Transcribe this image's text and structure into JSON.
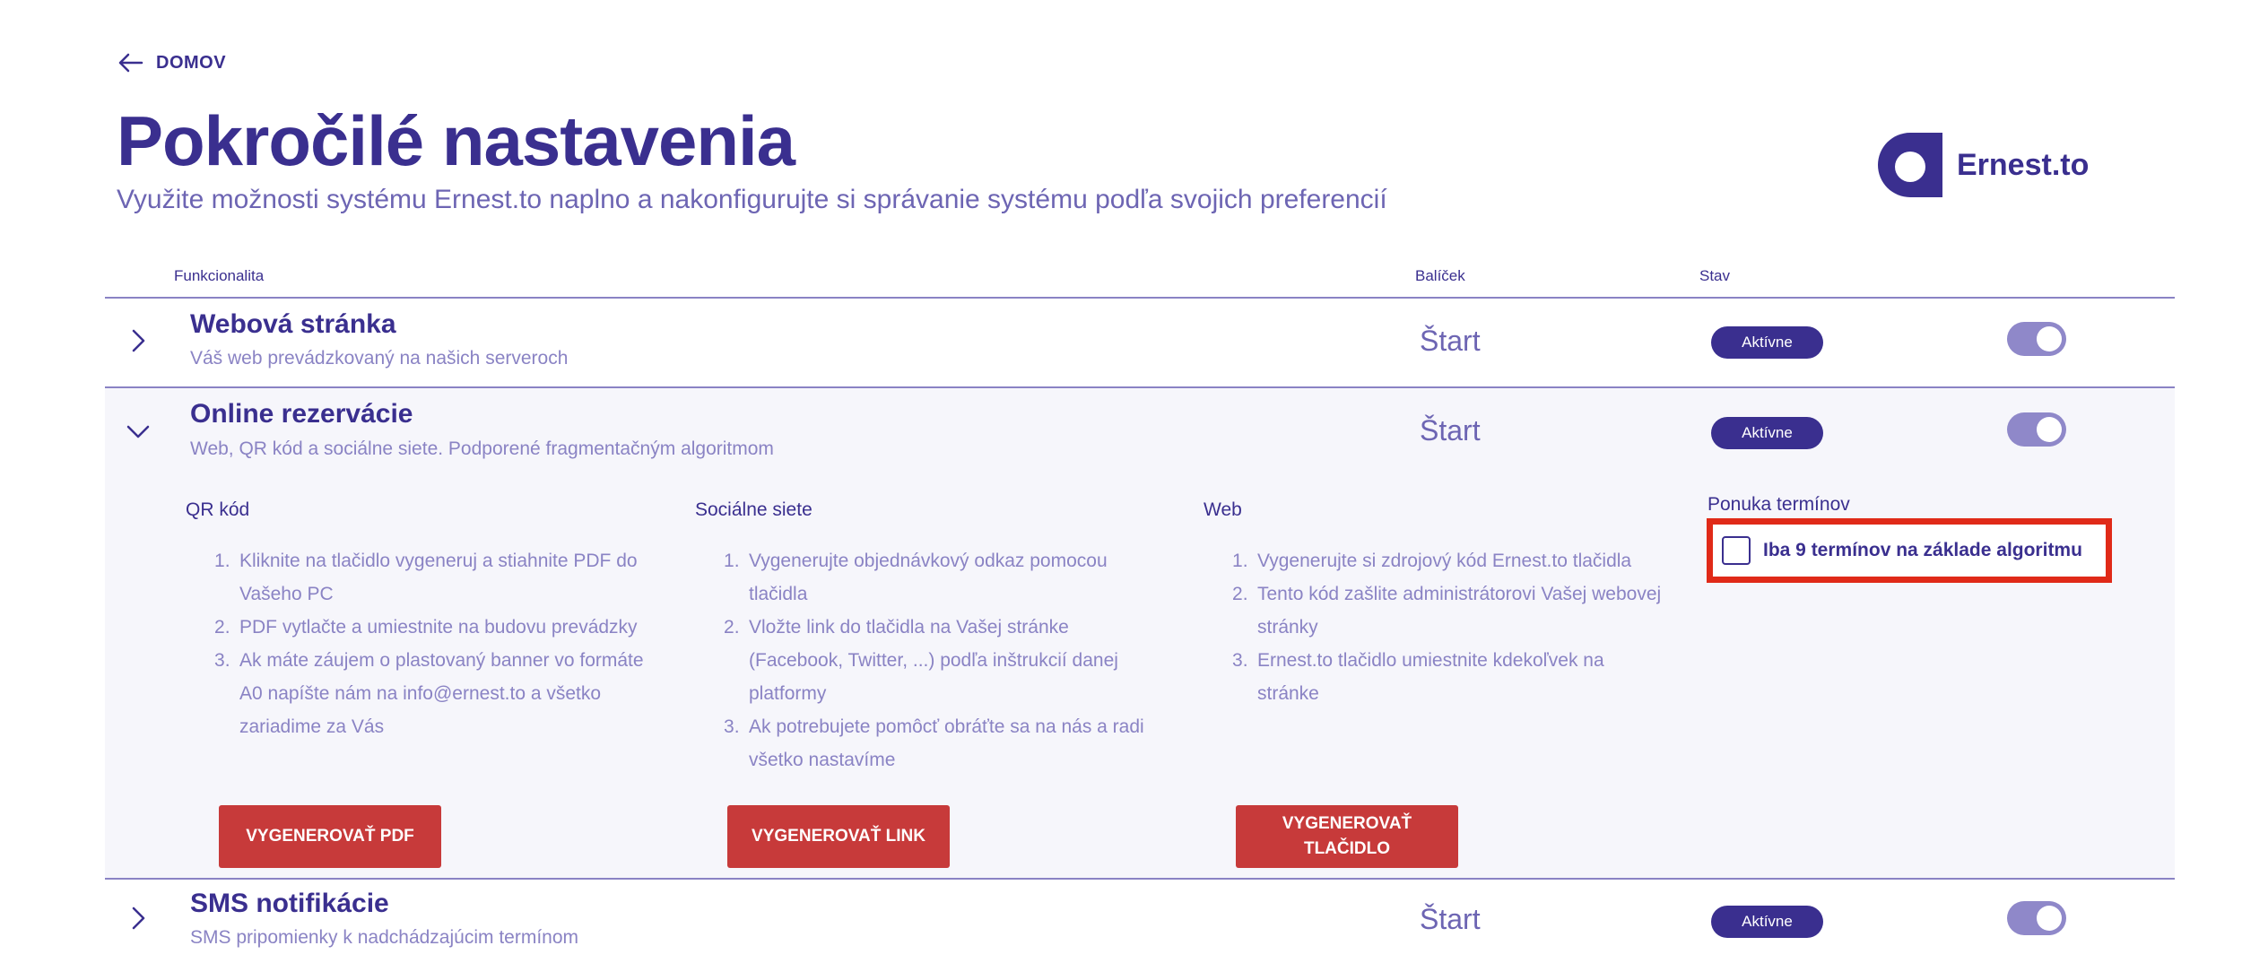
{
  "nav": {
    "back_label": "DOMOV"
  },
  "header": {
    "title": "Pokročilé nastavenia",
    "subtitle": "Využite možnosti systému Ernest.to naplno a nakonfigurujte si správanie systému podľa svojich preferencií"
  },
  "logo": {
    "text": "Ernest.to"
  },
  "table": {
    "columns": {
      "feature": "Funkcionalita",
      "package": "Balíček",
      "state": "Stav"
    },
    "rows": [
      {
        "title": "Webová stránka",
        "desc": "Váš web prevádzkovaný na našich serveroch",
        "package": "Štart",
        "status": "Aktívne",
        "enabled": true
      },
      {
        "title": "Online rezervácie",
        "desc": "Web, QR kód a sociálne siete. Podporené fragmentačným algoritmom",
        "package": "Štart",
        "status": "Aktívne",
        "enabled": true
      },
      {
        "title": "SMS notifikácie",
        "desc": "SMS pripomienky k nadchádzajúcim termínom",
        "package": "Štart",
        "status": "Aktívne",
        "enabled": true
      }
    ]
  },
  "reservations": {
    "qr": {
      "title": "QR kód",
      "steps": [
        "Kliknite na tlačidlo vygeneruj a stiahnite PDF do Vašeho PC",
        "PDF vytlačte a umiestnite na budovu prevádzky",
        "Ak máte záujem o plastovaný banner vo formáte A0 napíšte nám na info@ernest.to a všetko zariadime za Vás"
      ],
      "button": "VYGENEROVAŤ PDF"
    },
    "social": {
      "title": "Sociálne siete",
      "steps": [
        "Vygenerujte objednávkový odkaz pomocou tlačidla",
        "Vložte link do tlačidla na Vašej stránke (Facebook, Twitter, ...) podľa inštrukcií danej platformy",
        "Ak potrebujete pomôcť obráťte sa na nás a radi všetko nastavíme"
      ],
      "button": "VYGENEROVAŤ LINK"
    },
    "web": {
      "title": "Web",
      "steps": [
        "Vygenerujte si zdrojový kód Ernest.to tlačidla",
        "Tento kód zašlite administrátorovi Vašej webovej stránky",
        "Ernest.to tlačidlo umiestnite kdekoľvek na stránke"
      ],
      "button": "VYGENEROVAŤ TLAČIDLO"
    },
    "offer": {
      "title": "Ponuka termínov",
      "checkbox_label": "Iba 9 termínov na základe algoritmu",
      "checked": false
    }
  },
  "colors": {
    "primary": "#3a2f8f",
    "muted": "#8a83c4",
    "accent_button": "#c73a3a",
    "highlight": "#e02a18"
  }
}
